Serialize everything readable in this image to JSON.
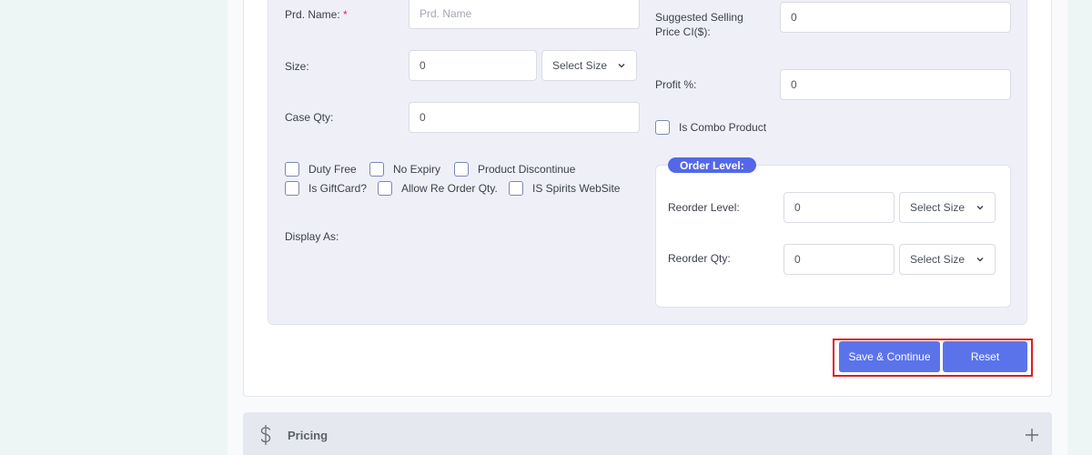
{
  "form": {
    "prd_name_label": "Prd. Name:",
    "required_mark": "*",
    "prd_name_placeholder": "Prd. Name",
    "size_label": "Size:",
    "size_value": "0",
    "size_unit": "Select Size",
    "case_qty_label": "Case Qty:",
    "case_qty_value": "0",
    "suggested_price_label_line1": "Suggested Selling",
    "suggested_price_label_line2": "Price CI($):",
    "suggested_price_value": "0",
    "profit_label": "Profit %:",
    "profit_value": "0",
    "combo_label": "Is Combo Product",
    "display_as_label": "Display As:"
  },
  "checkboxes": {
    "duty_free": "Duty Free",
    "no_expiry": "No Expiry",
    "product_discontinue": "Product Discontinue",
    "is_giftcard": "Is GiftCard?",
    "allow_reorder": "Allow Re Order Qty.",
    "spirits_website": "IS Spirits WebSite"
  },
  "order_level": {
    "title": "Order Level:",
    "reorder_level_label": "Reorder Level:",
    "reorder_level_value": "0",
    "reorder_level_unit": "Select Size",
    "reorder_qty_label": "Reorder Qty:",
    "reorder_qty_value": "0",
    "reorder_qty_unit": "Select Size"
  },
  "actions": {
    "save_continue": "Save & Continue",
    "reset": "Reset"
  },
  "pricing": {
    "label": "Pricing"
  },
  "colors": {
    "accent": "#5b73ea",
    "badge": "#5468e7",
    "highlight": "#e01b22"
  }
}
